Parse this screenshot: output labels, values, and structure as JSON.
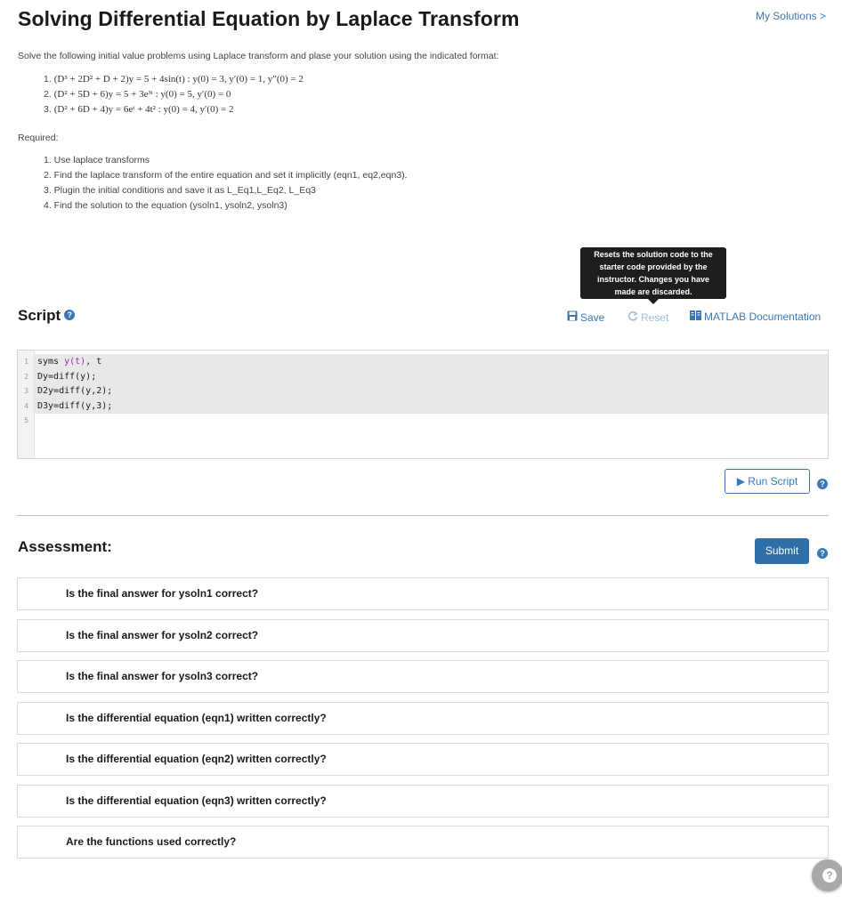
{
  "header": {
    "title": "Solving Differential Equation by Laplace Transform",
    "my_solutions": "My Solutions >"
  },
  "problem": {
    "intro": "Solve the following initial value problems using Laplace transform and plase your solution using the indicated format:",
    "items": [
      {
        "num": "1.",
        "equation": "(D³ + 2D² + D + 2)y = 5 + 4sin(t) : y(0) = 3, y′(0) = 1, y″(0) = 2"
      },
      {
        "num": "2.",
        "equation": "(D² + 5D + 6)y = 5 + 3e³ᵗ : y(0) = 5, y′(0) = 0"
      },
      {
        "num": "3.",
        "equation": "(D² + 6D + 4)y = 6eᵗ + 4t² : y(0) = 4, y′(0) = 2"
      }
    ],
    "required_label": "Required:",
    "required": [
      "1. Use laplace transforms",
      "2. Find the laplace transform of the entire equation and set it implicitly (eqn1, eq2,eqn3).",
      "3. Plugin the initial conditions and save it as L_Eq1,L_Eq2, L_Eq3",
      "4. Find the solution to the equation (ysoln1, ysoln2, ysoln3)"
    ]
  },
  "tooltip": {
    "text": "Resets the solution code to the starter code provided by the instructor. Changes you have made are discarded."
  },
  "script": {
    "heading": "Script",
    "help": "?",
    "save_label": "Save",
    "reset_label": "Reset",
    "docs_label": "MATLAB Documentation",
    "lines": [
      {
        "n": "1",
        "pre": "syms ",
        "var": "y(t)",
        "post": ", t"
      },
      {
        "n": "2",
        "pre": "Dy=diff(y);",
        "var": "",
        "post": ""
      },
      {
        "n": "3",
        "pre": "D2y=diff(y,2);",
        "var": "",
        "post": ""
      },
      {
        "n": "4",
        "pre": "D3y=diff(y,3);",
        "var": "",
        "post": ""
      },
      {
        "n": "5",
        "pre": "",
        "var": "",
        "post": ""
      }
    ],
    "run_label": "▶ Run Script"
  },
  "assessment": {
    "heading": "Assessment:",
    "submit_label": "Submit",
    "items": [
      "Is the final answer for ysoln1 correct?",
      "Is the final answer for ysoln2 correct?",
      "Is the final answer for ysoln3 correct?",
      "Is the differential equation (eqn1) written correctly?",
      "Is the differential equation (eqn2) written correctly?",
      "Is the differential equation (eqn3) written correctly?",
      "Are the functions used correctly?"
    ]
  },
  "float_help": "?",
  "colors": {
    "link": "#3a79b5",
    "submit": "#2f6fa7",
    "code_var": "#a32cb4"
  }
}
